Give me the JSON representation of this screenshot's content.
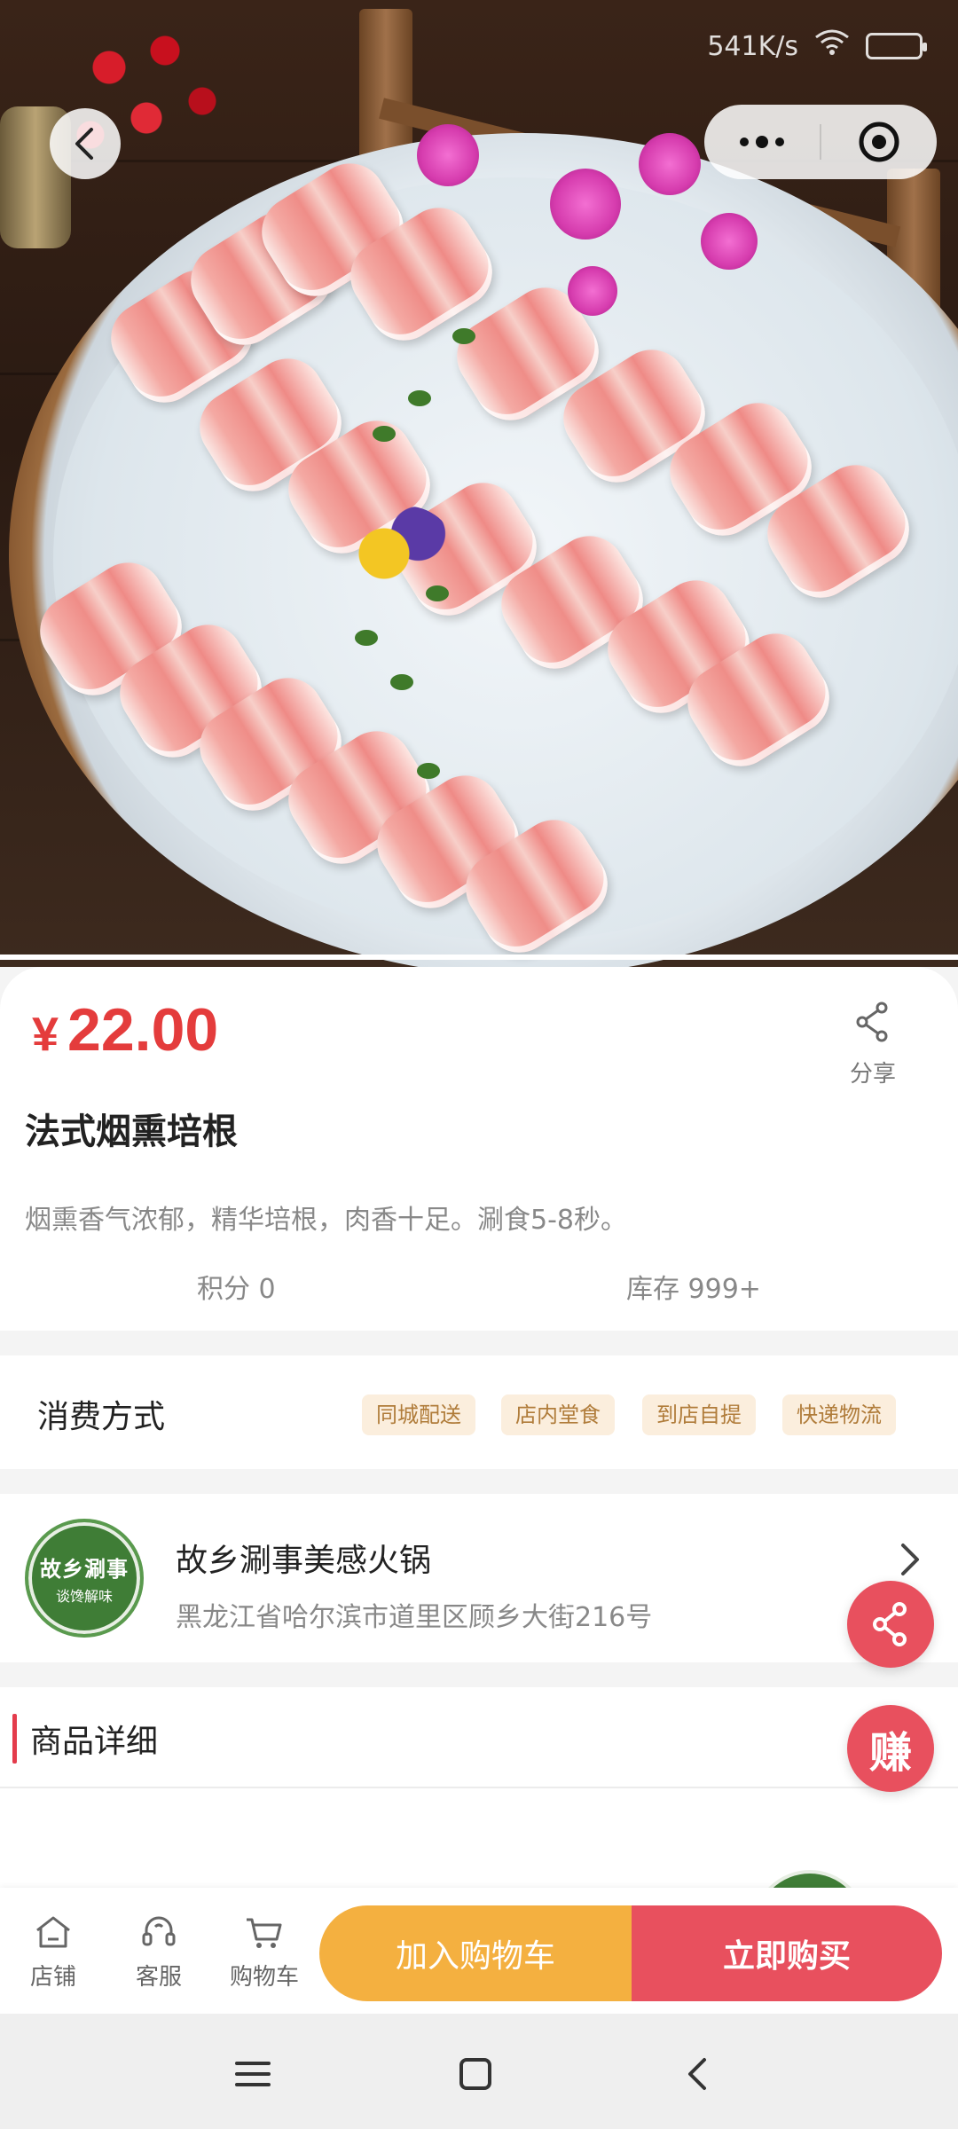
{
  "status_bar": {
    "net_speed": "541K/s"
  },
  "product": {
    "currency": "¥",
    "price": "22.00",
    "title": "法式烟熏培根",
    "description": "烟熏香气浓郁，精华培根，肉香十足。涮食5-8秒。",
    "points": "积分 0",
    "stock": "库存 999+",
    "share_label": "分享"
  },
  "consume": {
    "label": "消费方式",
    "tags": [
      "同城配送",
      "店内堂食",
      "到店自提",
      "快递物流"
    ]
  },
  "store": {
    "name": "故乡涮事美感火锅",
    "address": "黑龙江省哈尔滨市道里区顾乡大街216号",
    "logo_text_main": "故乡涮事",
    "logo_text_sub": "谈馋解味"
  },
  "floating": {
    "earn_label": "赚"
  },
  "details": {
    "heading": "商品详细"
  },
  "bottom_bar": {
    "shop": "店铺",
    "service": "客服",
    "cart": "购物车",
    "add_to_cart": "加入购物车",
    "buy_now": "立即购买"
  },
  "colors": {
    "price_red": "#e43c3c",
    "buy_red": "#e8505e",
    "cart_orange": "#f4b040",
    "tag_bg": "#fbeedd",
    "tag_text": "#b07c3a"
  },
  "icons": [
    "back-icon",
    "more-icon",
    "target-icon",
    "share-icon",
    "chevron-right-icon",
    "store-icon",
    "headset-icon",
    "cart-icon",
    "menu-icon",
    "home-square-icon",
    "back-nav-icon"
  ]
}
